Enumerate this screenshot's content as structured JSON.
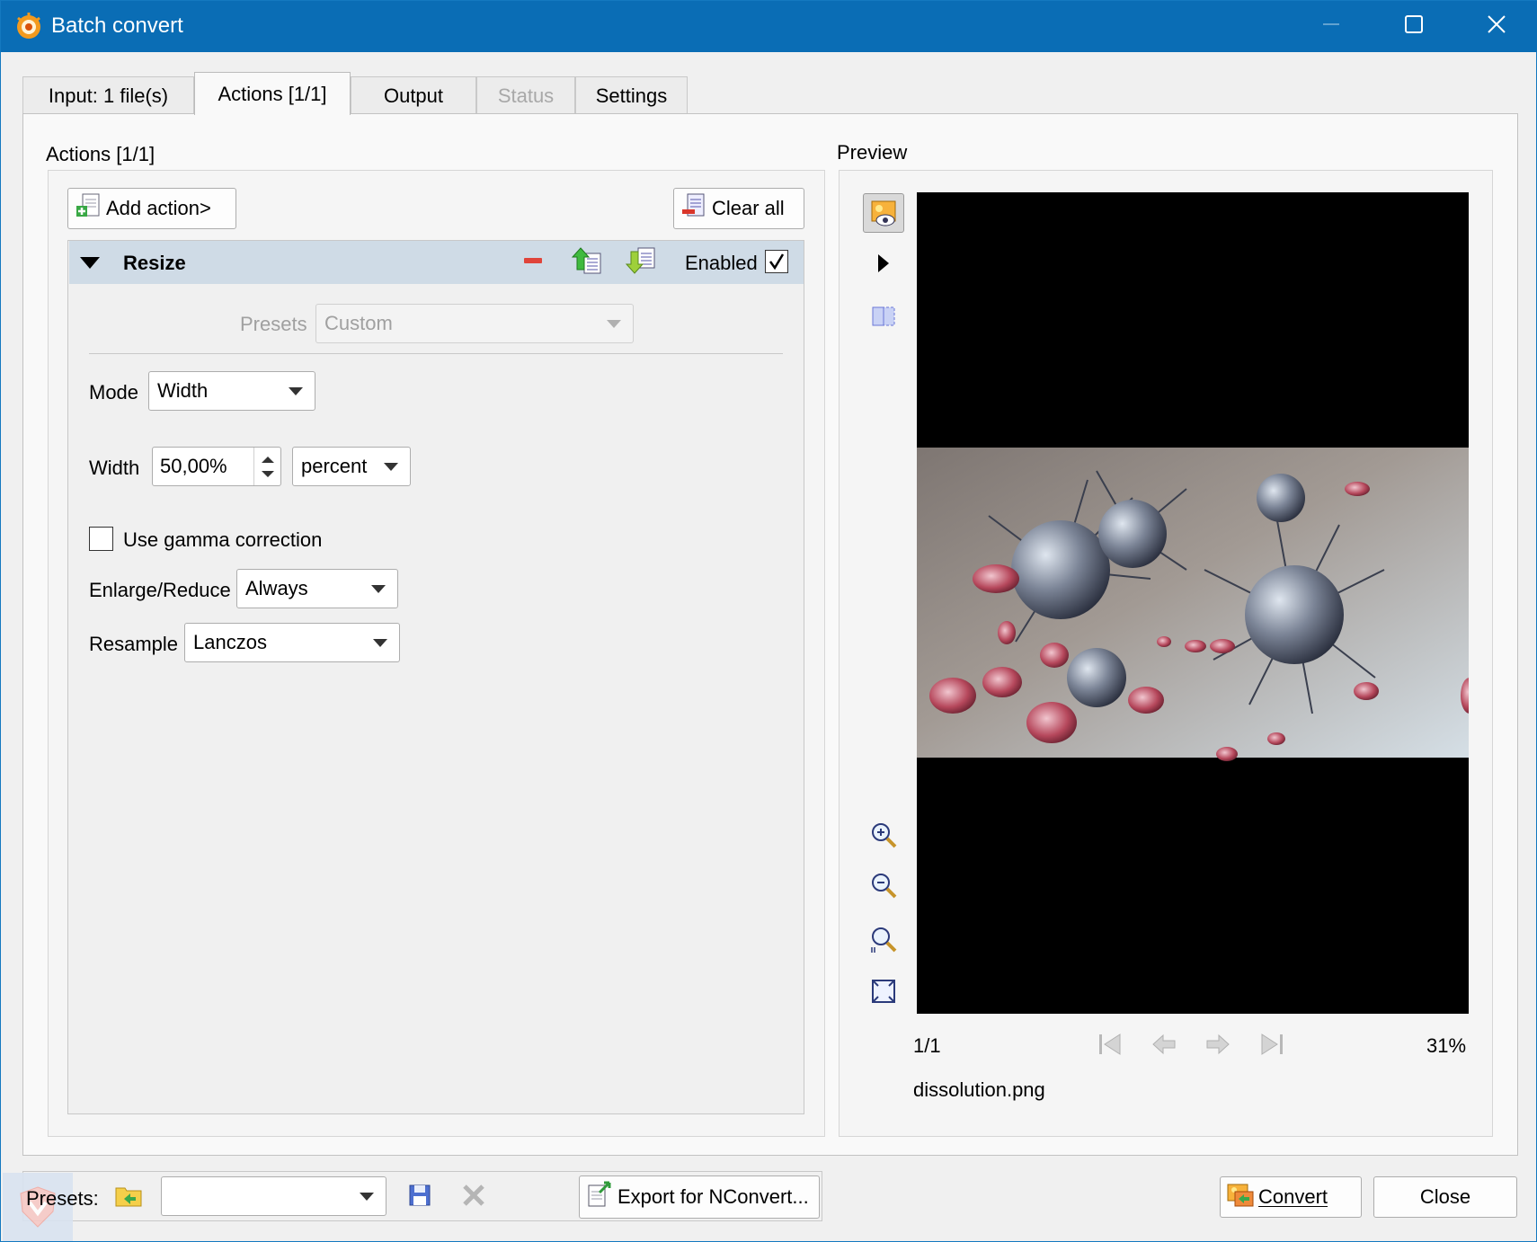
{
  "window": {
    "title": "Batch convert",
    "accent": "#0a6db5"
  },
  "tabs": [
    {
      "label": "Input: 1 file(s)"
    },
    {
      "label": "Actions [1/1]",
      "active": true
    },
    {
      "label": "Output"
    },
    {
      "label": "Status",
      "disabled": true
    },
    {
      "label": "Settings"
    }
  ],
  "actions": {
    "group_label": "Actions [1/1]",
    "add_action_label": "Add action>",
    "clear_all_label": "Clear all",
    "resize": {
      "title": "Resize",
      "enabled_label": "Enabled",
      "enabled": true,
      "presets_label": "Presets",
      "presets_value": "Custom",
      "mode_label": "Mode",
      "mode_value": "Width",
      "width_label": "Width",
      "width_value": "50,00%",
      "width_unit": "percent",
      "gamma_label": "Use gamma correction",
      "gamma_checked": false,
      "enlarge_label": "Enlarge/Reduce",
      "enlarge_value": "Always",
      "resample_label": "Resample",
      "resample_value": "Lanczos"
    }
  },
  "preview": {
    "label": "Preview",
    "page": "1/1",
    "zoom": "31%",
    "filename": "dissolution.png"
  },
  "bottom": {
    "presets_label": "Presets:",
    "presets_value": "",
    "export_label": "Export for NConvert...",
    "convert_label": "Convert",
    "close_label": "Close"
  }
}
